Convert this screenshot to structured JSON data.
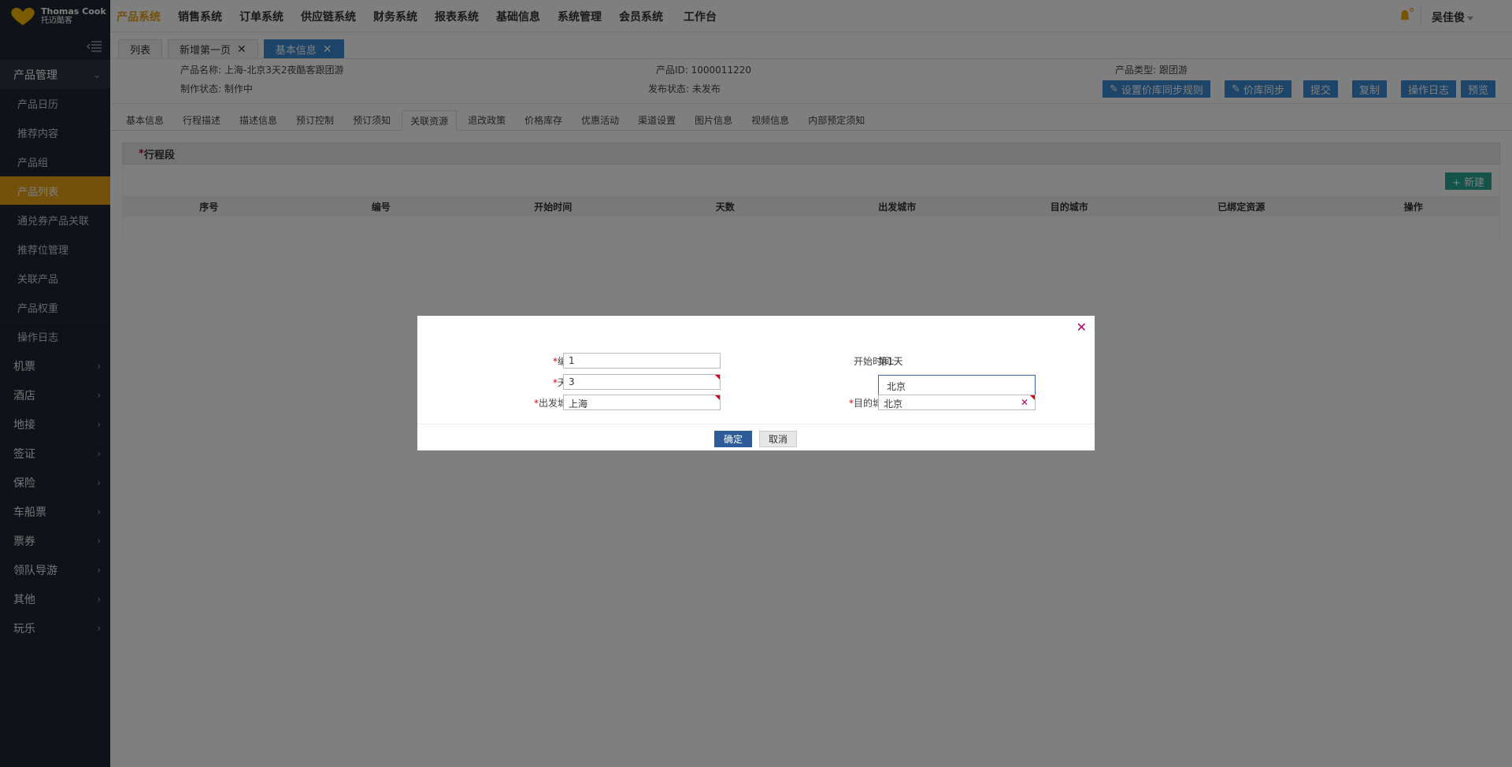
{
  "logo": {
    "en": "Thomas Cook",
    "cn": "托迈酷客"
  },
  "nav": [
    "产品系统",
    "销售系统",
    "订单系统",
    "供应链系统",
    "财务系统",
    "报表系统",
    "基础信息",
    "系统管理",
    "会员系统",
    "工作台"
  ],
  "user": "吴佳俊",
  "sidebar": {
    "group": "产品管理",
    "subs": [
      "产品日历",
      "推荐内容",
      "产品组",
      "产品列表",
      "通兑券产品关联",
      "推荐位管理",
      "关联产品",
      "产品权重",
      "操作日志"
    ],
    "items": [
      "机票",
      "酒店",
      "地接",
      "签证",
      "保险",
      "车船票",
      "票券",
      "领队导游",
      "其他",
      "玩乐"
    ]
  },
  "tabs": {
    "list": "列表",
    "new_page": "新增第一页",
    "basic": "基本信息"
  },
  "info": {
    "name": "产品名称: 上海-北京3天2夜酷客跟团游",
    "id": "产品ID: 1000011220",
    "type": "产品类型: 跟团游",
    "make_status": "制作状态: 制作中",
    "publish_status": "发布状态: 未发布"
  },
  "actions": {
    "sync_rule": "设置价库同步规则",
    "sync": "价库同步",
    "submit": "提交",
    "copy": "复制",
    "log": "操作日志",
    "preview": "预览"
  },
  "subtabs": [
    "基本信息",
    "行程描述",
    "描述信息",
    "预订控制",
    "预订须知",
    "关联资源",
    "退改政策",
    "价格库存",
    "优惠活动",
    "渠道设置",
    "图片信息",
    "视频信息",
    "内部预定须知"
  ],
  "panel": {
    "title": "行程段",
    "new_btn": "+ 新建",
    "columns": [
      "序号",
      "编号",
      "开始时间",
      "天数",
      "出发城市",
      "目的城市",
      "已绑定资源",
      "操作"
    ]
  },
  "modal": {
    "code_label": "编号:",
    "code_value": "1",
    "days_label": "天数:",
    "days_value": "3",
    "from_label": "出发城市:",
    "from_value": "上海",
    "start_label": "开始时间:",
    "start_value": "第1天",
    "to_label": "目的城市:",
    "to_value": "北京",
    "suggestion": "北京",
    "ok": "确定",
    "cancel": "取消"
  }
}
